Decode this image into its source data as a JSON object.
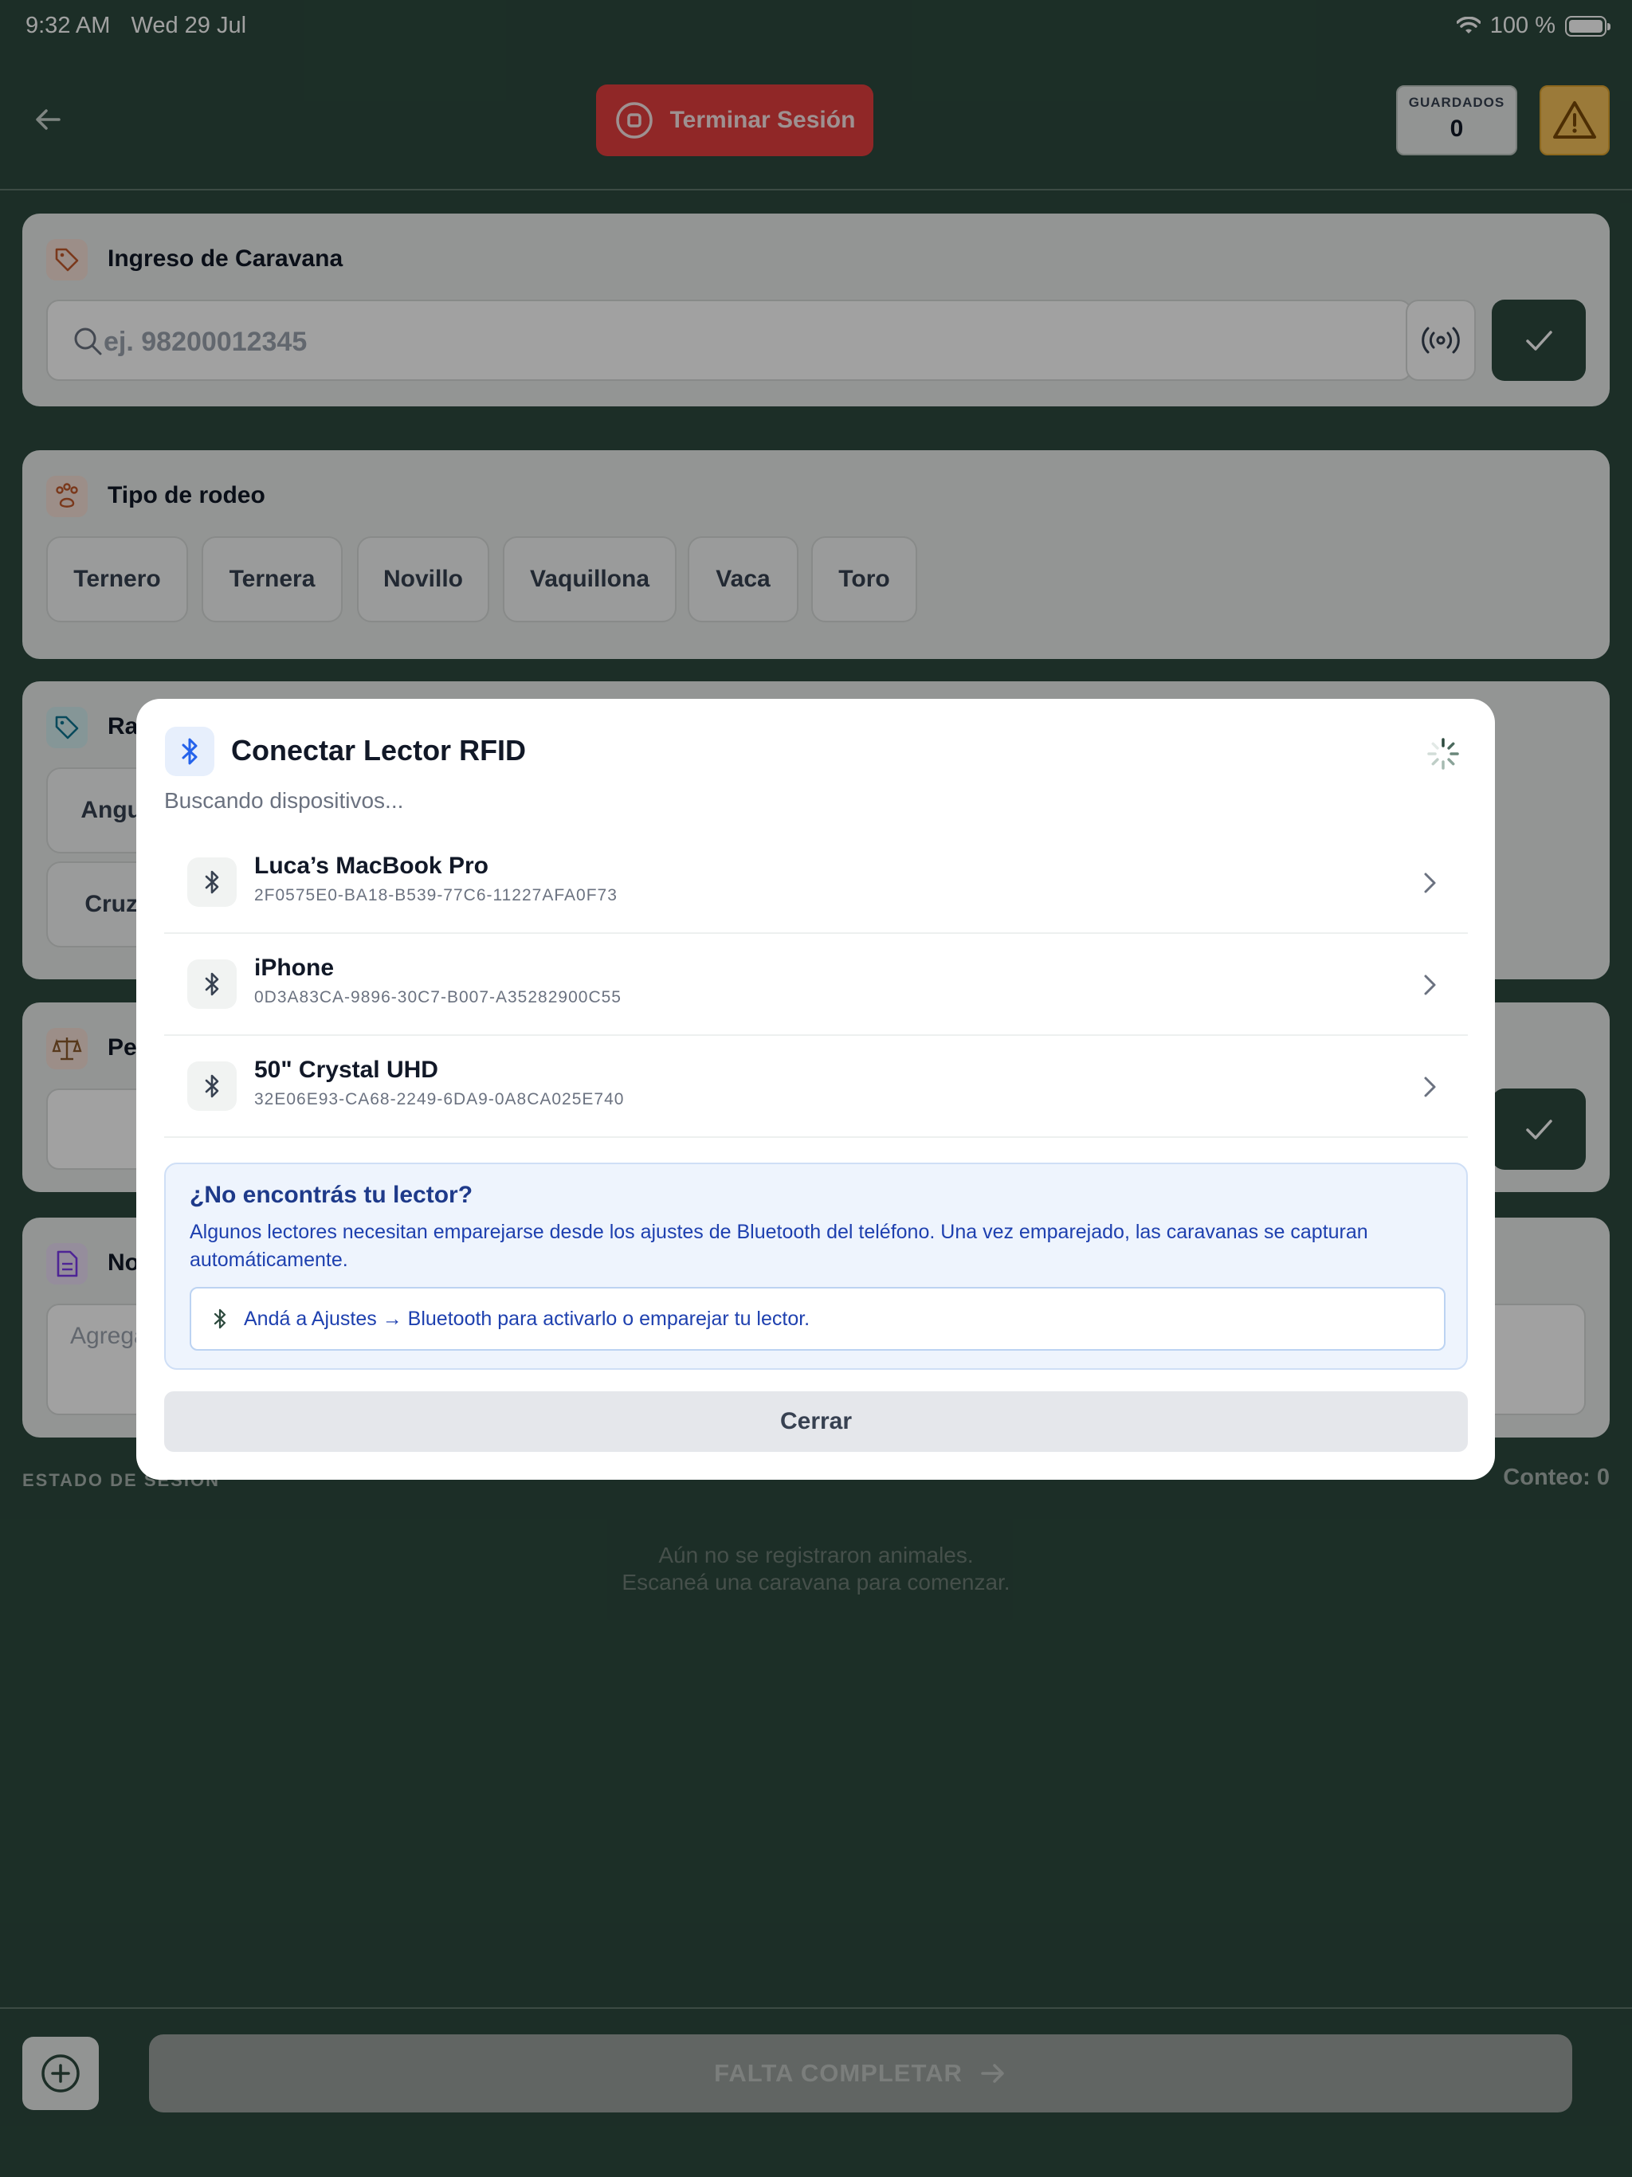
{
  "status_bar": {
    "time": "9:32 AM",
    "date": "Wed 29 Jul",
    "battery": "100 %"
  },
  "header": {
    "end_session_label": "Terminar Sesión",
    "saved_label": "GUARDADOS",
    "saved_count": "0",
    "colors": {
      "end_session": "#e53e3e",
      "warning": "#f5c25b",
      "background": "#2d4a3e"
    }
  },
  "caravana_card": {
    "title": "Ingreso de Caravana",
    "input_placeholder": "ej. 98200012345"
  },
  "rodeo_card": {
    "title": "Tipo de rodeo",
    "options": [
      "Ternero",
      "Ternera",
      "Novillo",
      "Vaquillona",
      "Vaca",
      "Toro"
    ]
  },
  "raza_card": {
    "title_visible": "Ra",
    "options_visible": [
      "Angus",
      "Cruza"
    ]
  },
  "peso_card": {
    "title_visible": "Pe"
  },
  "notas_card": {
    "title_visible": "No",
    "placeholder_visible": "Agrega"
  },
  "session": {
    "state_label": "ESTADO DE SESIÓN",
    "count_label": "Conteo: 0",
    "empty_line1": "Aún no se registraron animales.",
    "empty_line2": "Escaneá una caravana para comenzar."
  },
  "footer": {
    "complete_label": "FALTA COMPLETAR"
  },
  "modal": {
    "title": "Conectar Lector RFID",
    "subtitle": "Buscando dispositivos...",
    "devices": [
      {
        "name": "Luca’s MacBook Pro",
        "id": "2F0575E0-BA18-B539-77C6-11227AFA0F73"
      },
      {
        "name": "iPhone",
        "id": "0D3A83CA-9896-30C7-B007-A35282900C55"
      },
      {
        "name": "50\" Crystal UHD",
        "id": "32E06E93-CA68-2249-6DA9-0A8CA025E740"
      }
    ],
    "help_title": "¿No encontrás tu lector?",
    "help_body": "Algunos lectores necesitan emparejarse desde los ajustes de Bluetooth del teléfono. Una vez emparejado, las caravanas se capturan automáticamente.",
    "help_tip": "Andá a Ajustes → Bluetooth para activarlo o emparejar tu lector.",
    "close_label": "Cerrar"
  },
  "icons": [
    "wifi-icon",
    "battery-icon",
    "back-arrow-icon",
    "stop-circle-icon",
    "warning-triangle-icon",
    "tag-icon",
    "search-icon",
    "rfid-broadcast-icon",
    "check-icon",
    "paw-icon",
    "scale-icon",
    "document-icon",
    "bluetooth-icon",
    "spinner-icon",
    "chevron-right-icon",
    "plus-circle-icon",
    "arrow-right-icon"
  ]
}
